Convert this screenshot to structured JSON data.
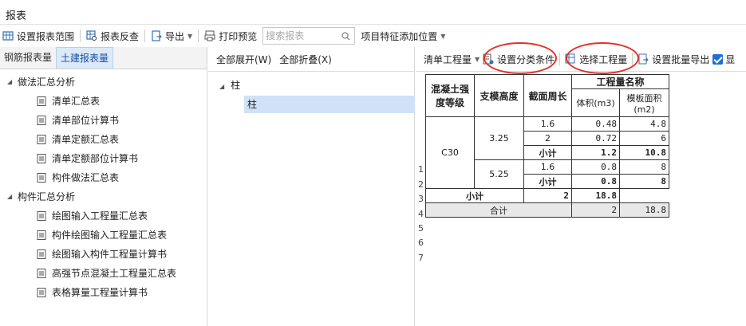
{
  "window": {
    "title": "报表"
  },
  "toolbar": {
    "set_range": "设置报表范围",
    "check": "报表反查",
    "export": "导出",
    "print_preview": "打印预览",
    "search_placeholder": "搜索报表",
    "add_position": "项目特征添加位置"
  },
  "left_tabs": [
    "钢筋报表量",
    "土建报表量"
  ],
  "tree": {
    "group1": "做法汇总分析",
    "group1_items": [
      "清单汇总表",
      "清单部位计算书",
      "清单定额汇总表",
      "清单定额部位计算书",
      "构件做法汇总表"
    ],
    "group2": "构件汇总分析",
    "group2_items": [
      "绘图输入工程量汇总表",
      "构件绘图输入工程量汇总表",
      "绘图输入构件工程量计算书",
      "高强节点混凝土工程量汇总表",
      "表格算量工程量计算书"
    ]
  },
  "middle": {
    "expand_all": "全部展开(W)",
    "collapse_all": "全部折叠(X)",
    "parent": "柱",
    "child": "柱"
  },
  "right_toolbar": {
    "qty_type": "清单工程量",
    "set_category": "设置分类条件",
    "select_qty": "选择工程量",
    "batch_export": "设置批量导出",
    "show_label": "显"
  },
  "table": {
    "h_grade": "混凝土强度等级",
    "h_height": "支模高度",
    "h_perim": "截面周长",
    "h_qty": "工程量名称",
    "h_vol": "体积(m3)",
    "h_area": "模板面积(m2)",
    "grade": "C30",
    "height1": "3.25",
    "height2": "5.25",
    "r1_perim": "1.6",
    "r1_vol": "0.48",
    "r1_area": "4.8",
    "r2_perim": "2",
    "r2_vol": "0.72",
    "r2_area": "6",
    "sub_label": "小计",
    "r3_vol": "1.2",
    "r3_area": "10.8",
    "r4_perim": "1.6",
    "r4_vol": "0.8",
    "r4_area": "8",
    "r5_vol": "0.8",
    "r5_area": "8",
    "r6_vol": "2",
    "r6_area": "18.8",
    "total_label": "合计",
    "r7_vol": "2",
    "r7_area": "18.8",
    "row_numbers": [
      "1",
      "2",
      "3",
      "4",
      "5",
      "6",
      "7"
    ]
  }
}
